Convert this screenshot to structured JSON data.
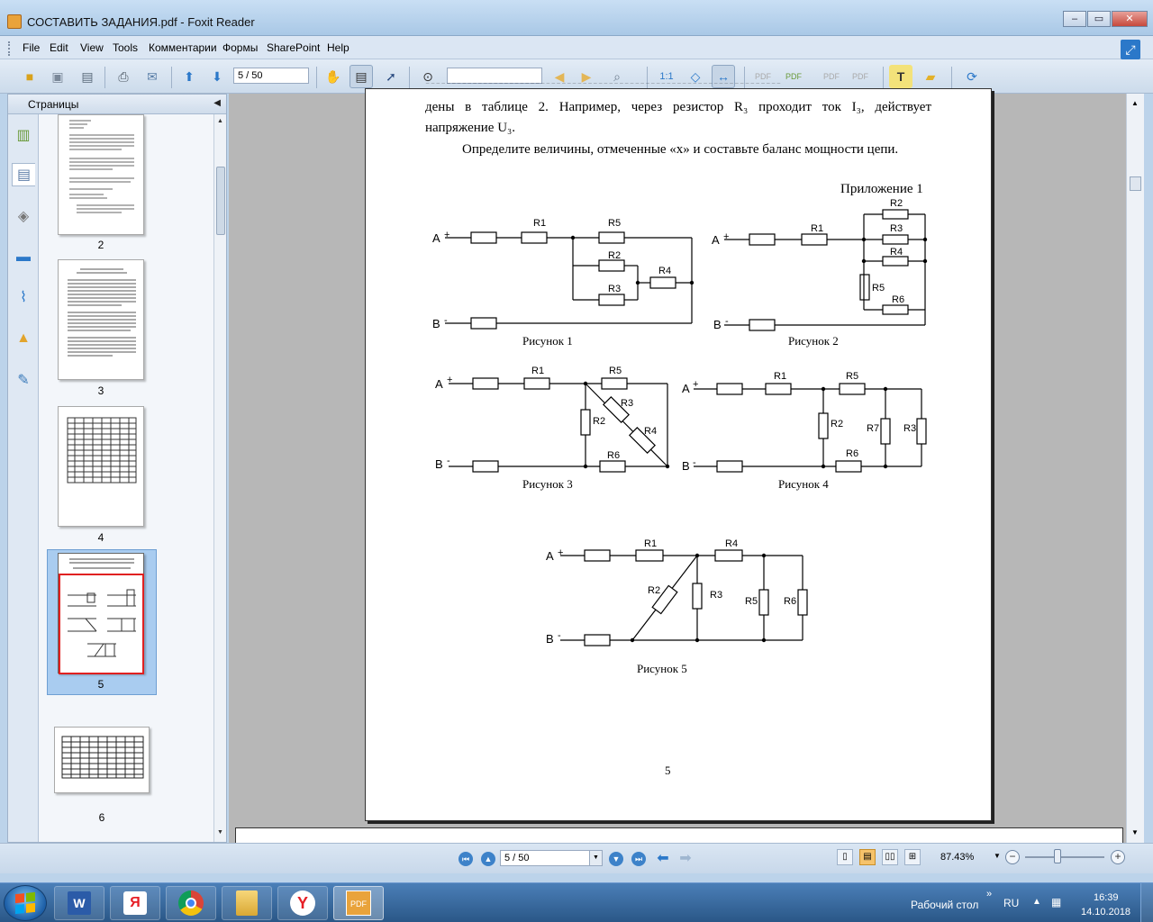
{
  "window": {
    "title": "СОСТАВИТЬ ЗАДАНИЯ.pdf - Foxit Reader",
    "minimize": "–",
    "restore": "▭",
    "close": "✕"
  },
  "menu": {
    "items": [
      "File",
      "Edit",
      "View",
      "Tools",
      "Комментарии",
      "Формы",
      "SharePoint",
      "Help"
    ]
  },
  "toolbar": {
    "page_value": "5 / 50",
    "search_value": ""
  },
  "sidebar": {
    "title": "Страницы",
    "thumbnail_labels": [
      "2",
      "3",
      "4",
      "5",
      "6"
    ],
    "selected_page": "5"
  },
  "document": {
    "line1": "дены в таблице 2. Например, через резистор R₃ проходит ток I₃, действует",
    "line2": "напряжение U₃.",
    "line3": "Определите величины, отмеченные «х» и составьте баланс мощности цепи.",
    "appendix": "Приложение 1",
    "page_number": "5",
    "figures": {
      "fig1": "Рисунок 1",
      "fig2": "Рисунок 2",
      "fig3": "Рисунок 3",
      "fig4": "Рисунок 4",
      "fig5": "Рисунок 5"
    },
    "terminals": {
      "a": "A",
      "b": "B",
      "plus": "+",
      "minus": "-"
    },
    "resistors": {
      "r1": "R1",
      "r2": "R2",
      "r3": "R3",
      "r4": "R4",
      "r5": "R5",
      "r6": "R6",
      "r7": "R7"
    }
  },
  "statusbar": {
    "page_value": "5 / 50",
    "zoom": "87.43%"
  },
  "taskbar": {
    "language": "RU",
    "desktop_label": "Рабочий стол",
    "time": "16:39",
    "date": "14.10.2018",
    "chevron": "»"
  },
  "colors": {
    "selection_border": "#e02020",
    "accent": "#2b78c9"
  }
}
